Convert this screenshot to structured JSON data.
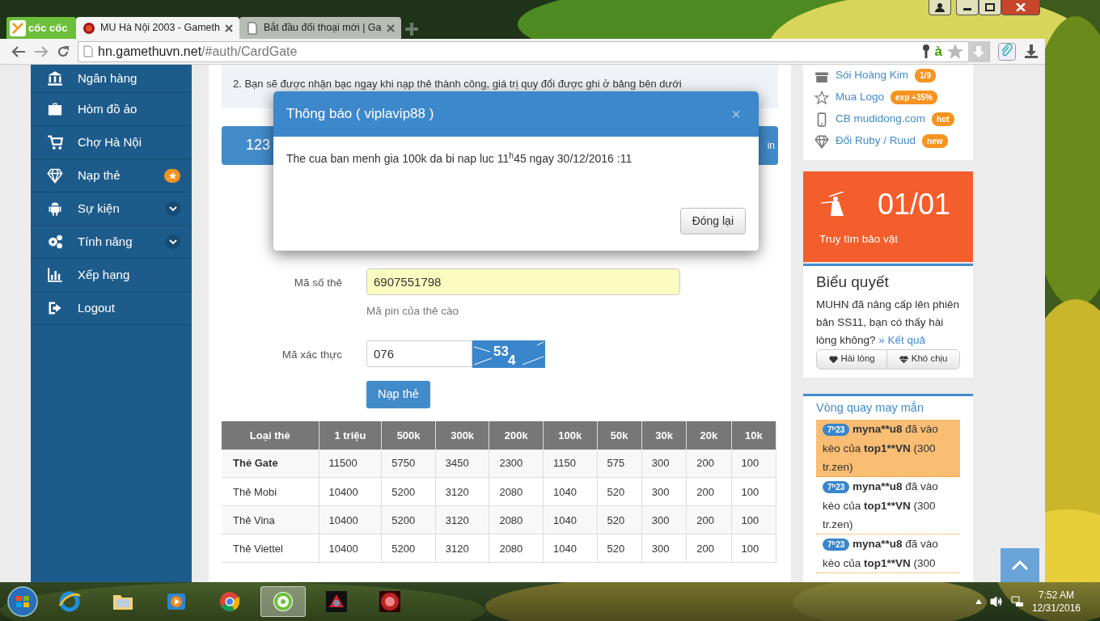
{
  "browser": {
    "brand": "cốc cốc",
    "tabs": [
      {
        "title": "MU Hà Nội 2003 - Gameth",
        "selected": true
      },
      {
        "title": "Bắt đầu đối thoại mới | Ga",
        "selected": false
      }
    ],
    "url_host": "hn.gamethuvn.net",
    "url_path": "/#auth/CardGate",
    "typing_mode": "à"
  },
  "sidebar": {
    "items": [
      {
        "label": "Ngân hàng",
        "kind": "plain"
      },
      {
        "label": "Hòm đồ ảo",
        "kind": "plain"
      },
      {
        "label": "Chợ Hà Nội",
        "kind": "plain"
      },
      {
        "label": "Nạp thẻ",
        "kind": "starred"
      },
      {
        "label": "Sự kiện",
        "kind": "dropdown"
      },
      {
        "label": "Tính năng",
        "kind": "dropdown"
      },
      {
        "label": "Xếp hạng",
        "kind": "plain"
      },
      {
        "label": "Logout",
        "kind": "plain"
      }
    ]
  },
  "notice": {
    "line": "2. Bạn sẽ được nhận bạc ngay khi nạp thẻ thành công, giá trị quy đổi được ghi ở bảng bên dưới"
  },
  "balance_bar": {
    "amount": "123",
    "edge_text": "in"
  },
  "form": {
    "fields": [
      {
        "kind": "text",
        "label": "Mã số thẻ",
        "value": "6907551798",
        "help": "Mã pin của thẻ cào",
        "autofilled": true
      },
      {
        "kind": "captcha",
        "label": "Mã xác thực",
        "value": "076",
        "captcha_text": "534",
        "autofilled": false
      }
    ],
    "submit": "Nạp thẻ"
  },
  "rates": {
    "columns": [
      "Loại thẻ",
      "1 triệu",
      "500k",
      "300k",
      "200k",
      "100k",
      "50k",
      "30k",
      "20k",
      "10k"
    ],
    "rows": [
      {
        "cells": [
          "Thẻ Gate",
          "11500",
          "5750",
          "3450",
          "2300",
          "1150",
          "575",
          "300",
          "200",
          "100"
        ],
        "emphasis": true
      },
      {
        "cells": [
          "Thẻ Mobi",
          "10400",
          "5200",
          "3120",
          "2080",
          "1040",
          "520",
          "300",
          "200",
          "100"
        ],
        "emphasis": false
      },
      {
        "cells": [
          "Thẻ Vina",
          "10400",
          "5200",
          "3120",
          "2080",
          "1040",
          "520",
          "300",
          "200",
          "100"
        ],
        "emphasis": false
      },
      {
        "cells": [
          "Thẻ Viettel",
          "10400",
          "5200",
          "3120",
          "2080",
          "1040",
          "520",
          "300",
          "200",
          "100"
        ],
        "emphasis": false
      }
    ]
  },
  "modal": {
    "title": "Thông báo ( viplavip88 )",
    "close": "×",
    "message": "The cua ban menh gia 100k da bi nap luc 11$^{h}$45 ngay 30/12/2016 :11",
    "button": "Đóng lại"
  },
  "right": {
    "links": [
      {
        "label": "Sói Hoàng Kim",
        "badge": "1/9"
      },
      {
        "label": "Mua Logo",
        "badge": "exp +35%"
      },
      {
        "label": "CB mudidong.com",
        "badge": "hot"
      },
      {
        "label": "Đổi Ruby / Ruud",
        "badge": "new"
      }
    ],
    "treasure": {
      "count": "01/01",
      "label": "Truy tìm bảo vật"
    },
    "poll": {
      "title": "Biểu quyết",
      "question": "MUHN đã nâng cấp lên phiên bản SS11, bạn có thấy hài lòng không?",
      "result_link": "» Kết quả",
      "options": [
        "Hài lòng",
        "Khó chịu"
      ]
    },
    "wheel": {
      "title": "Vòng quay may mắn",
      "entries": [
        {
          "time": "7$^{h}$23",
          "user": "myna**u8",
          "action": "đã vào kèo của",
          "target": "top1**VN",
          "prize": "(300 tr.zen)",
          "highlighted": true
        },
        {
          "time": "7$^{h}$23",
          "user": "myna**u8",
          "action": "đã vào kèo của",
          "target": "top1**VN",
          "prize": "(300 tr.zen)",
          "highlighted": false
        },
        {
          "time": "7$^{h}$23",
          "user": "myna**u8",
          "action": "đã vào kèo của",
          "target": "top1**VN",
          "prize": "(300",
          "highlighted": false
        }
      ]
    }
  },
  "taskbar": {
    "apps": [
      {
        "kind": "ie",
        "selected": false
      },
      {
        "kind": "folder",
        "selected": false
      },
      {
        "kind": "media",
        "selected": false
      },
      {
        "kind": "chrome",
        "selected": false
      },
      {
        "kind": "coccoc",
        "selected": true
      },
      {
        "kind": "game",
        "selected": false
      },
      {
        "kind": "game2",
        "selected": false
      }
    ],
    "time": "7:52 AM",
    "date": "12/31/2016"
  }
}
